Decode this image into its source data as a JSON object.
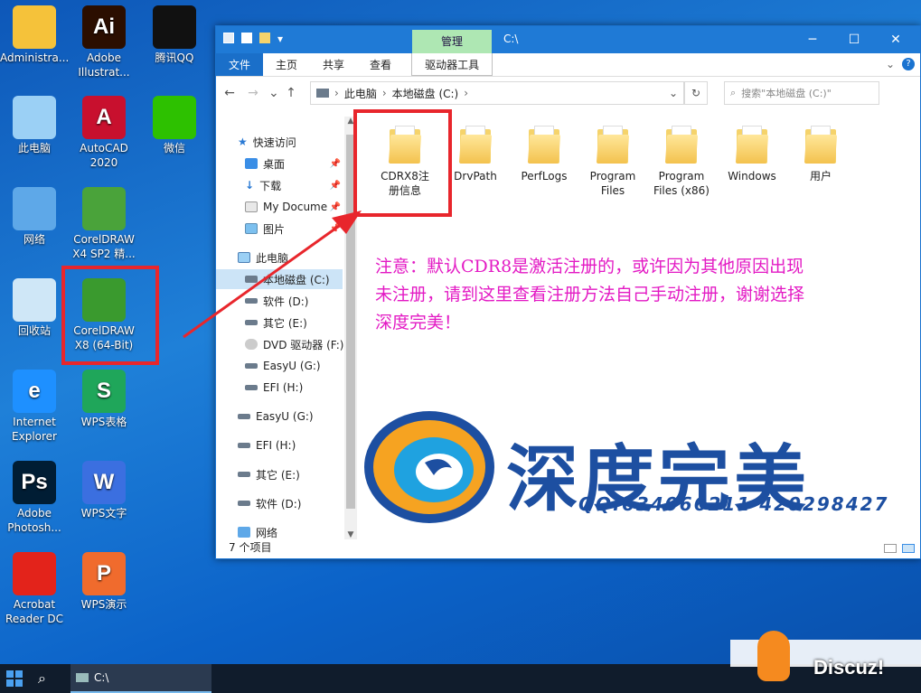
{
  "desktop": {
    "icons": [
      {
        "label": "Administra...",
        "glyph": "",
        "color": "#f5c23a",
        "icon": "user-folder-icon"
      },
      {
        "label": "Adobe Illustrat...",
        "glyph": "Ai",
        "color": "#2b0e00",
        "icon": "illustrator-icon"
      },
      {
        "label": "腾讯QQ",
        "glyph": "",
        "color": "#111111",
        "icon": "qq-penguin-icon"
      },
      {
        "label": "此电脑",
        "glyph": "",
        "color": "#9bd0f5",
        "icon": "computer-icon"
      },
      {
        "label": "AutoCAD 2020",
        "glyph": "A",
        "color": "#c8102e",
        "icon": "autocad-icon"
      },
      {
        "label": "微信",
        "glyph": "",
        "color": "#2dc100",
        "icon": "wechat-icon"
      },
      {
        "label": "网络",
        "glyph": "",
        "color": "#5ea8e8",
        "icon": "network-icon"
      },
      {
        "label": "CorelDRAW X4 SP2 精...",
        "glyph": "",
        "color": "#4aa33a",
        "icon": "coreldraw-icon"
      },
      {
        "label": "回收站",
        "glyph": "",
        "color": "#cfe7f7",
        "icon": "recycle-bin-icon"
      },
      {
        "label": "CorelDRAW X8 (64-Bit)",
        "glyph": "",
        "color": "#3a9a2e",
        "icon": "coreldraw-icon"
      },
      {
        "label": "Internet Explorer",
        "glyph": "e",
        "color": "#1e90ff",
        "icon": "internet-explorer-icon"
      },
      {
        "label": "WPS表格",
        "glyph": "S",
        "color": "#1fa65a",
        "icon": "wps-sheet-icon"
      },
      {
        "label": "Adobe Photosh...",
        "glyph": "Ps",
        "color": "#001d34",
        "icon": "photoshop-icon"
      },
      {
        "label": "WPS文字",
        "glyph": "W",
        "color": "#3b6fe0",
        "icon": "wps-writer-icon"
      },
      {
        "label": "Acrobat Reader DC",
        "glyph": "",
        "color": "#e3231b",
        "icon": "acrobat-icon"
      },
      {
        "label": "WPS演示",
        "glyph": "P",
        "color": "#f06b2d",
        "icon": "wps-presentation-icon"
      }
    ]
  },
  "explorer": {
    "title": "C:\\",
    "manage_tab": "管理",
    "ribbon_tabs": [
      "文件",
      "主页",
      "共享",
      "查看"
    ],
    "drive_tools_tab": "驱动器工具",
    "breadcrumb": [
      "此电脑",
      "本地磁盘 (C:)"
    ],
    "search_placeholder": "搜索\"本地磁盘 (C:)\"",
    "nav": {
      "quick_access": "快速访问",
      "items": [
        "桌面",
        "下载",
        "My Docume",
        "图片",
        "此电脑",
        "本地磁盘 (C:)",
        "软件 (D:)",
        "其它 (E:)",
        "DVD 驱动器 (F:)",
        "EasyU (G:)",
        "EFI (H:)",
        "EasyU (G:)",
        "EFI (H:)",
        "其它 (E:)",
        "软件 (D:)",
        "网络"
      ]
    },
    "folders": [
      {
        "name": "CDRX8注册信息",
        "line1": "CDRX8注",
        "line2": "册信息"
      },
      {
        "name": "DrvPath",
        "line1": "DrvPath",
        "line2": ""
      },
      {
        "name": "PerfLogs",
        "line1": "PerfLogs",
        "line2": ""
      },
      {
        "name": "Program Files",
        "line1": "Program",
        "line2": "Files"
      },
      {
        "name": "Program Files (x86)",
        "line1": "Program",
        "line2": "Files (x86)"
      },
      {
        "name": "Windows",
        "line1": "Windows",
        "line2": ""
      },
      {
        "name": "用户",
        "line1": "用户",
        "line2": ""
      }
    ],
    "status": "7 个项目"
  },
  "annotation": {
    "notice_lines": [
      "注意：默认CDR8是激活注册的，或许因为其他原因出现",
      "未注册，请到这里查看注册方法自己手动注册，谢谢选择",
      "深度完美！"
    ],
    "logo_text": "深度完美",
    "logo_qq": "QQ:634066211  420298427",
    "accent": "#e8262c"
  },
  "taskbar": {
    "app_label": "C:\\"
  },
  "watermark": {
    "text": "Discuz!"
  }
}
